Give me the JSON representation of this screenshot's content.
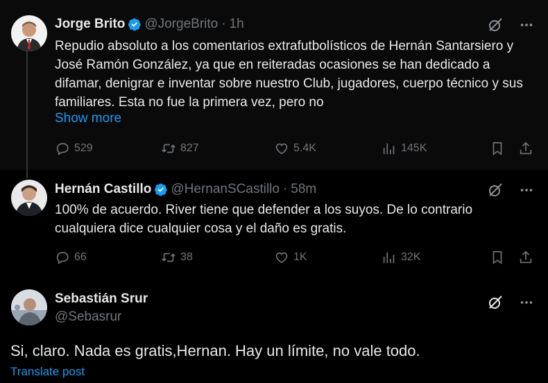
{
  "tweets": [
    {
      "name": "Jorge Brito",
      "handle": "@JorgeBrito",
      "separator": "·",
      "time": "1h",
      "text": "Repudio absoluto a los comentarios extrafutbolísticos de Hernán Santarsiero y José Ramón González, ya que en reiteradas ocasiones se han dedicado a difamar, denigrar e inventar sobre nuestro Club, jugadores, cuerpo técnico y sus familiares. Esta no fue la primera vez, pero no",
      "show_more": "Show more",
      "replies": "529",
      "reposts": "827",
      "likes": "5.4K",
      "views": "145K"
    },
    {
      "name": "Hernán Castillo",
      "handle": "@HernanSCastillo",
      "separator": "·",
      "time": "58m",
      "text": "100% de acuerdo. River tiene que defender a los suyos. De lo contrario cualquiera dice cualquier cosa y el daño es gratis.",
      "replies": "66",
      "reposts": "38",
      "likes": "1K",
      "views": "32K"
    },
    {
      "name": "Sebastián Srur",
      "handle": "@Sebasrur",
      "text": "Si, claro. Nada es gratis,Hernan. Hay un límite, no vale todo.",
      "translate": "Translate post"
    }
  ],
  "colors": {
    "background": "#000000",
    "text": "#e7e9ea",
    "muted": "#71767b",
    "accent": "#1d9bf0"
  },
  "icons": [
    "verified-badge-icon",
    "grok-icon",
    "more-icon",
    "reply-icon",
    "repost-icon",
    "like-icon",
    "views-icon",
    "bookmark-icon",
    "share-icon"
  ]
}
